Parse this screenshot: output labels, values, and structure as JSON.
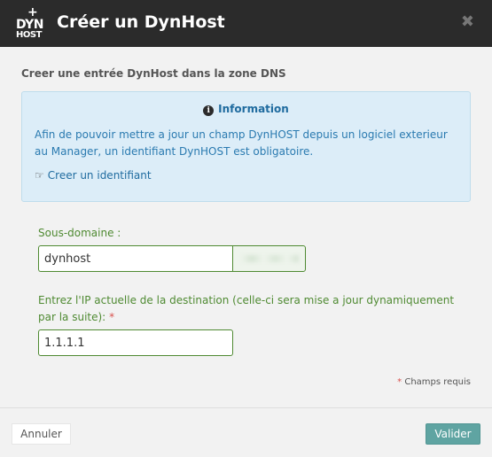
{
  "header": {
    "logo": {
      "plus": "+",
      "line1": "DYN",
      "line2": "HOST"
    },
    "title": "Créer un DynHost",
    "close_glyph": "✖"
  },
  "subtitle": "Creer une entrée DynHost dans la zone DNS",
  "info": {
    "icon_glyph": "i",
    "heading": "Information",
    "text": "Afin de pouvoir mettre a jour un champ DynHOST depuis un logiciel exterieur au Manager, un identifiant DynHOST est obligatoire.",
    "link_icon": "☞",
    "link_label": "Creer un identifiant"
  },
  "form": {
    "subdomain": {
      "label": "Sous-domaine :",
      "value": "dynhost"
    },
    "ip": {
      "label": "Entrez l'IP actuelle de la destination (celle-ci sera mise a jour dynamiquement par la suite):",
      "required_marker": "*",
      "value": "1.1.1.1"
    },
    "required_note": {
      "marker": "*",
      "text": "Champs requis"
    }
  },
  "footer": {
    "cancel_label": "Annuler",
    "submit_label": "Valider"
  },
  "colors": {
    "header_bg": "#2b2b2b",
    "info_bg": "#dcedf8",
    "info_text": "#2a7ab0",
    "field_border": "#4f8a32",
    "submit_bg": "#5fa4a2"
  }
}
